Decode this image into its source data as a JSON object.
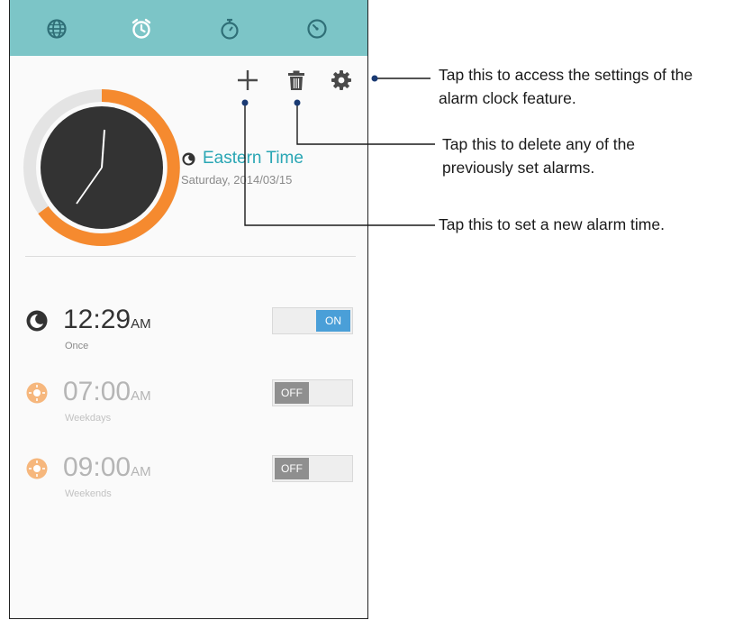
{
  "tabs": [
    {
      "name": "world-clock",
      "icon": "globe-icon"
    },
    {
      "name": "alarm",
      "icon": "alarm-clock-icon",
      "active": true
    },
    {
      "name": "stopwatch",
      "icon": "stopwatch-icon"
    },
    {
      "name": "timer",
      "icon": "timer-icon"
    }
  ],
  "toolbar": {
    "add_icon": "plus-icon",
    "delete_icon": "trash-icon",
    "settings_icon": "gear-icon"
  },
  "timezone": {
    "name": "Eastern Time",
    "date": "Saturday, 2014/03/15"
  },
  "alarms": [
    {
      "time": "12:29",
      "ampm": "AM",
      "repeat": "Once",
      "state": "ON",
      "enabled": true,
      "icon": "moon-icon"
    },
    {
      "time": "07:00",
      "ampm": "AM",
      "repeat": "Weekdays",
      "state": "OFF",
      "enabled": false,
      "icon": "sun-icon"
    },
    {
      "time": "09:00",
      "ampm": "AM",
      "repeat": "Weekends",
      "state": "OFF",
      "enabled": false,
      "icon": "sun-icon"
    }
  ],
  "callouts": {
    "settings": [
      "Tap this to access the settings of the",
      "alarm clock feature."
    ],
    "delete": [
      "Tap this to delete any of the",
      "previously set alarms."
    ],
    "add": [
      "Tap this to set a new alarm time."
    ]
  },
  "colors": {
    "tabbar": "#7cc5c7",
    "accent_orange": "#f58a2f",
    "accent_teal": "#29a6b4",
    "toggle_on": "#4a9fd8",
    "toggle_off": "#8f8f8f",
    "clock_face": "#333333"
  }
}
